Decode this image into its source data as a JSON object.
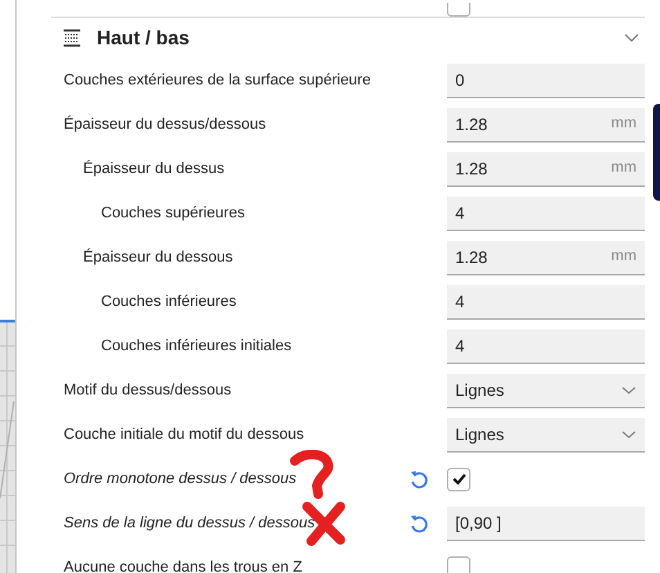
{
  "top_row": {
    "checked": false
  },
  "section": {
    "title": "Haut / bas",
    "expanded": true
  },
  "settings": [
    {
      "kind": "text",
      "label": "Couches extérieures de la surface supérieure",
      "value": "0"
    },
    {
      "kind": "text",
      "label": "Épaisseur du dessus/dessous",
      "value": "1.28",
      "unit": "mm",
      "children": [
        {
          "kind": "text",
          "label": "Épaisseur du dessus",
          "value": "1.28",
          "unit": "mm",
          "children": [
            {
              "kind": "text",
              "label": "Couches supérieures",
              "value": "4"
            }
          ]
        },
        {
          "kind": "text",
          "label": "Épaisseur du dessous",
          "value": "1.28",
          "unit": "mm",
          "children": [
            {
              "kind": "text",
              "label": "Couches inférieures",
              "value": "4"
            },
            {
              "kind": "text",
              "label": "Couches inférieures initiales",
              "value": "4"
            }
          ]
        }
      ]
    },
    {
      "kind": "dropdown",
      "label": "Motif du dessus/dessous",
      "value": "Lignes"
    },
    {
      "kind": "dropdown",
      "label": "Couche initiale du motif du dessous",
      "value": "Lignes"
    },
    {
      "kind": "checkbox",
      "label": "Ordre monotone dessus / dessous",
      "checked": true,
      "modified": true
    },
    {
      "kind": "text",
      "label": "Sens de la ligne du dessus / dessous",
      "value": "[0,90 ]",
      "modified": true
    },
    {
      "kind": "checkbox",
      "label": "Aucune couche dans les trous en Z",
      "checked": false
    }
  ]
}
